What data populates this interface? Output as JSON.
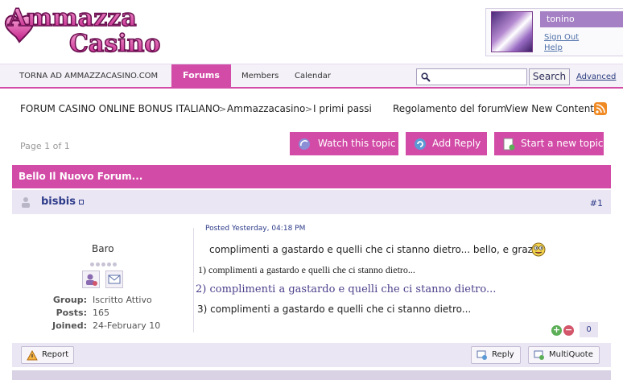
{
  "header": {
    "logo_text_top": "Ammazza",
    "logo_text_bottom": "Casino",
    "username": "tonino",
    "sign_out": "Sign Out",
    "help": "Help"
  },
  "nav": {
    "home_link": "TORNA AD AMMAZZACASINO.COM",
    "forums": "Forums",
    "members": "Members",
    "calendar": "Calendar",
    "search_placeholder": "",
    "search_button": "Search",
    "advanced": "Advanced"
  },
  "breadcrumb": {
    "items": [
      "FORUM CASINO ONLINE BONUS ITALIANO",
      "Ammazzacasino",
      "I primi passi"
    ],
    "separator": ">",
    "rules": "Regolamento del forum",
    "view_new": "View New Content"
  },
  "toolbar": {
    "page_info": "Page 1 of 1",
    "watch": "Watch this topic",
    "add_reply": "Add Reply",
    "new_topic": "Start a new topic"
  },
  "topic": {
    "title": "Bello Il Nuovo Forum..."
  },
  "post": {
    "author": "bisbis",
    "number": "#1",
    "author_display": "Baro",
    "group_label": "Group:",
    "group_value": "Iscritto Attivo",
    "posts_label": "Posts:",
    "posts_value": "165",
    "joined_label": "Joined:",
    "joined_value": "24-February 10",
    "posted_at": "Posted Yesterday, 04:18 PM",
    "lines": [
      "complimenti a gastardo e quelli che ci stanno dietro... bello, e grazie",
      "1) complimenti a gastardo e quelli che ci stanno dietro...",
      "2) complimenti a gastardo e quelli che ci stanno dietro...",
      "3) complimenti a gastardo e quelli che ci stanno dietro..."
    ],
    "reputation": "0",
    "report": "Report",
    "reply": "Reply",
    "multiquote": "MultiQuote"
  },
  "colors": {
    "brand_pink": "#d24ba6",
    "link_blue": "#2d3b8a",
    "rss_orange": "#f08a24"
  },
  "icons": [
    "search-icon",
    "watch-icon",
    "reply-icon",
    "new-topic-icon",
    "rss-icon",
    "user-icon",
    "warning-icon",
    "smiley-icon"
  ]
}
